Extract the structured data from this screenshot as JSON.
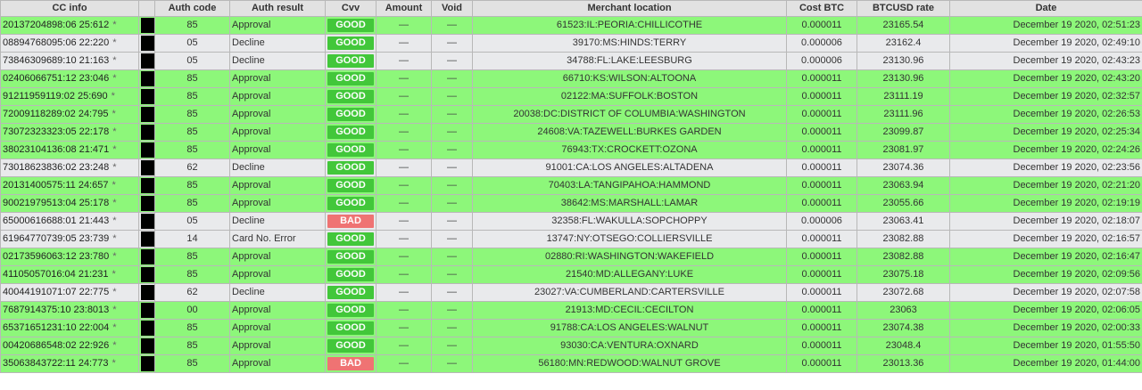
{
  "columns": {
    "cc_info": "CC info",
    "auth_code": "Auth code",
    "auth_result": "Auth result",
    "cvv": "Cvv",
    "amount": "Amount",
    "void": "Void",
    "merchant_location": "Merchant location",
    "cost_btc": "Cost BTC",
    "btcusd_rate": "BTCUSD rate",
    "date": "Date"
  },
  "colors": {
    "approval_row": "#8df77a",
    "decline_row": "#e9eaec",
    "good_badge": "#42c73a",
    "bad_badge": "#ef7373"
  },
  "rows": [
    {
      "cc": "20137204898:06 25:612",
      "star": "*",
      "auth_code": "85",
      "auth_result": "Approval",
      "cvv": "GOOD",
      "amount": "—",
      "void": "—",
      "location": "61523:IL:PEORIA:CHILLICOTHE",
      "cost_btc": "0.000011",
      "rate": "23165.54",
      "date": "December 19 2020, 02:51:23"
    },
    {
      "cc": "08894768095:06 22:220",
      "star": "*",
      "auth_code": "05",
      "auth_result": "Decline",
      "cvv": "GOOD",
      "amount": "—",
      "void": "—",
      "location": "39170:MS:HINDS:TERRY",
      "cost_btc": "0.000006",
      "rate": "23162.4",
      "date": "December 19 2020, 02:49:10"
    },
    {
      "cc": "73846309689:10 21:163",
      "star": "*",
      "auth_code": "05",
      "auth_result": "Decline",
      "cvv": "GOOD",
      "amount": "—",
      "void": "—",
      "location": "34788:FL:LAKE:LEESBURG",
      "cost_btc": "0.000006",
      "rate": "23130.96",
      "date": "December 19 2020, 02:43:23"
    },
    {
      "cc": "02406066751:12 23:046",
      "star": "*",
      "auth_code": "85",
      "auth_result": "Approval",
      "cvv": "GOOD",
      "amount": "—",
      "void": "—",
      "location": "66710:KS:WILSON:ALTOONA",
      "cost_btc": "0.000011",
      "rate": "23130.96",
      "date": "December 19 2020, 02:43:20"
    },
    {
      "cc": "91211959119:02 25:690",
      "star": "*",
      "auth_code": "85",
      "auth_result": "Approval",
      "cvv": "GOOD",
      "amount": "—",
      "void": "—",
      "location": "02122:MA:SUFFOLK:BOSTON",
      "cost_btc": "0.000011",
      "rate": "23111.19",
      "date": "December 19 2020, 02:32:57"
    },
    {
      "cc": "72009118289:02 24:795",
      "star": "*",
      "auth_code": "85",
      "auth_result": "Approval",
      "cvv": "GOOD",
      "amount": "—",
      "void": "—",
      "location": "20038:DC:DISTRICT OF COLUMBIA:WASHINGTON",
      "cost_btc": "0.000011",
      "rate": "23111.96",
      "date": "December 19 2020, 02:26:53"
    },
    {
      "cc": "73072323323:05 22:178",
      "star": "*",
      "auth_code": "85",
      "auth_result": "Approval",
      "cvv": "GOOD",
      "amount": "—",
      "void": "—",
      "location": "24608:VA:TAZEWELL:BURKES GARDEN",
      "cost_btc": "0.000011",
      "rate": "23099.87",
      "date": "December 19 2020, 02:25:34"
    },
    {
      "cc": "38023104136:08 21:471",
      "star": "*",
      "auth_code": "85",
      "auth_result": "Approval",
      "cvv": "GOOD",
      "amount": "—",
      "void": "—",
      "location": "76943:TX:CROCKETT:OZONA",
      "cost_btc": "0.000011",
      "rate": "23081.97",
      "date": "December 19 2020, 02:24:26"
    },
    {
      "cc": "73018623836:02 23:248",
      "star": "*",
      "auth_code": "62",
      "auth_result": "Decline",
      "cvv": "GOOD",
      "amount": "—",
      "void": "—",
      "location": "91001:CA:LOS ANGELES:ALTADENA",
      "cost_btc": "0.000011",
      "rate": "23074.36",
      "date": "December 19 2020, 02:23:56"
    },
    {
      "cc": "20131400575:11 24:657",
      "star": "*",
      "auth_code": "85",
      "auth_result": "Approval",
      "cvv": "GOOD",
      "amount": "—",
      "void": "—",
      "location": "70403:LA:TANGIPAHOA:HAMMOND",
      "cost_btc": "0.000011",
      "rate": "23063.94",
      "date": "December 19 2020, 02:21:20"
    },
    {
      "cc": "90021979513:04 25:178",
      "star": "*",
      "auth_code": "85",
      "auth_result": "Approval",
      "cvv": "GOOD",
      "amount": "—",
      "void": "—",
      "location": "38642:MS:MARSHALL:LAMAR",
      "cost_btc": "0.000011",
      "rate": "23055.66",
      "date": "December 19 2020, 02:19:19"
    },
    {
      "cc": "65000616688:01 21:443",
      "star": "*",
      "auth_code": "05",
      "auth_result": "Decline",
      "cvv": "BAD",
      "amount": "—",
      "void": "—",
      "location": "32358:FL:WAKULLA:SOPCHOPPY",
      "cost_btc": "0.000006",
      "rate": "23063.41",
      "date": "December 19 2020, 02:18:07"
    },
    {
      "cc": "61964770739:05 23:739",
      "star": "*",
      "auth_code": "14",
      "auth_result": "Card No. Error",
      "cvv": "GOOD",
      "amount": "—",
      "void": "—",
      "location": "13747:NY:OTSEGO:COLLIERSVILLE",
      "cost_btc": "0.000011",
      "rate": "23082.88",
      "date": "December 19 2020, 02:16:57"
    },
    {
      "cc": "02173596063:12 23:780",
      "star": "*",
      "auth_code": "85",
      "auth_result": "Approval",
      "cvv": "GOOD",
      "amount": "—",
      "void": "—",
      "location": "02880:RI:WASHINGTON:WAKEFIELD",
      "cost_btc": "0.000011",
      "rate": "23082.88",
      "date": "December 19 2020, 02:16:47"
    },
    {
      "cc": "41105057016:04 21:231",
      "star": "*",
      "auth_code": "85",
      "auth_result": "Approval",
      "cvv": "GOOD",
      "amount": "—",
      "void": "—",
      "location": "21540:MD:ALLEGANY:LUKE",
      "cost_btc": "0.000011",
      "rate": "23075.18",
      "date": "December 19 2020, 02:09:56"
    },
    {
      "cc": "40044191071:07 22:775",
      "star": "*",
      "auth_code": "62",
      "auth_result": "Decline",
      "cvv": "GOOD",
      "amount": "—",
      "void": "—",
      "location": "23027:VA:CUMBERLAND:CARTERSVILLE",
      "cost_btc": "0.000011",
      "rate": "23072.68",
      "date": "December 19 2020, 02:07:58"
    },
    {
      "cc": "7687914375:10 23:8013",
      "star": "*",
      "auth_code": "00",
      "auth_result": "Approval",
      "cvv": "GOOD",
      "amount": "—",
      "void": "—",
      "location": "21913:MD:CECIL:CECILTON",
      "cost_btc": "0.000011",
      "rate": "23063",
      "date": "December 19 2020, 02:06:05"
    },
    {
      "cc": "65371651231:10 22:004",
      "star": "*",
      "auth_code": "85",
      "auth_result": "Approval",
      "cvv": "GOOD",
      "amount": "—",
      "void": "—",
      "location": "91788:CA:LOS ANGELES:WALNUT",
      "cost_btc": "0.000011",
      "rate": "23074.38",
      "date": "December 19 2020, 02:00:33"
    },
    {
      "cc": "00420686548:02 22:926",
      "star": "*",
      "auth_code": "85",
      "auth_result": "Approval",
      "cvv": "GOOD",
      "amount": "—",
      "void": "—",
      "location": "93030:CA:VENTURA:OXNARD",
      "cost_btc": "0.000011",
      "rate": "23048.4",
      "date": "December 19 2020, 01:55:50"
    },
    {
      "cc": "35063843722:11 24:773",
      "star": "*",
      "auth_code": "85",
      "auth_result": "Approval",
      "cvv": "BAD",
      "amount": "—",
      "void": "—",
      "location": "56180:MN:REDWOOD:WALNUT GROVE",
      "cost_btc": "0.000011",
      "rate": "23013.36",
      "date": "December 19 2020, 01:44:00"
    }
  ]
}
